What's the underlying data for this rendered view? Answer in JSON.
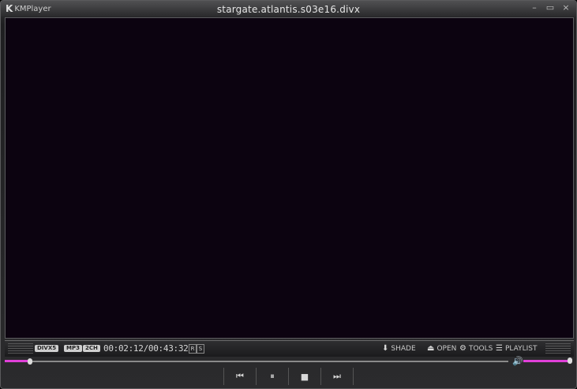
{
  "window": {
    "app_name": "KMPlayer",
    "title": "stargate.atlantis.s03e16.divx",
    "buttons": {
      "minimize": "–",
      "maximize": "▭",
      "close": "×"
    }
  },
  "status_bar": {
    "codec_video": "DIVX5",
    "codec_audio": "MP3",
    "channels": "2CH",
    "time_display": "00:02:12/00:43:32",
    "r_flag": "R",
    "s_flag": "S",
    "menu": {
      "shade": "SHADE",
      "open": "OPEN",
      "tools": "TOOLS",
      "playlist": "PLAYLIST"
    }
  },
  "playback": {
    "progress_fraction": 0.05,
    "volume_fraction": 1.0
  },
  "controls": {
    "prev": "⏮",
    "pause": "⏸",
    "stop": "■",
    "next": "⏭"
  },
  "colors": {
    "accent": "#e040d8",
    "video_bg": "#0c0310"
  }
}
